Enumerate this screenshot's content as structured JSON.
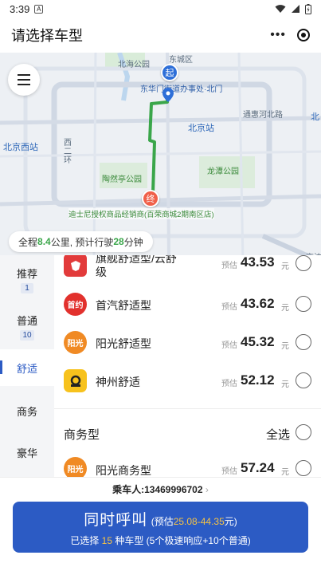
{
  "status_bar": {
    "time": "3:39",
    "notif": "A"
  },
  "header": {
    "title": "请选择车型",
    "more": "•••"
  },
  "map": {
    "labels": {
      "beihai": "北海公园",
      "dongcheng": "东城区",
      "dhm": "东华门街道办事处·北门",
      "tonghui": "通惠河北路",
      "bjz": "北京站",
      "bjxz": "北京西站",
      "erhuan": "西\n二\n环",
      "taoranting": "陶然亭公园",
      "longtan": "龙潭公园",
      "bei": "北",
      "jingshen": "京沈"
    },
    "start_marker": "起",
    "end_marker": "终",
    "destination": "迪士尼授权商品经销商(百荣商城2期南区店)",
    "trip": {
      "p1": "全程",
      "dist": "8.4",
      "p2": "公里, 预计行驶",
      "mins": "28",
      "p3": "分钟"
    }
  },
  "sidebar": {
    "categories": [
      {
        "label": "推荐",
        "count": "1"
      },
      {
        "label": "普通",
        "count": "10"
      },
      {
        "label": "舒适",
        "count": ""
      },
      {
        "label": "商务",
        "count": ""
      },
      {
        "label": "豪华",
        "count": ""
      }
    ]
  },
  "rides": [
    {
      "name_l1": "旗舰舒适型/云舒",
      "name_l2": "级",
      "est": "预估",
      "price": "43.53",
      "unit": "元",
      "logo_color": "#e23b3b"
    },
    {
      "name": "首汽舒适型",
      "logo_text": "首约",
      "est": "预估",
      "price": "43.62",
      "unit": "元",
      "logo_color": "#e2312d"
    },
    {
      "name": "阳光舒适型",
      "logo_text": "阳光",
      "est": "预估",
      "price": "45.32",
      "unit": "元",
      "logo_color": "#f08a24"
    },
    {
      "name": "神州舒适",
      "est": "预估",
      "price": "52.12",
      "unit": "元",
      "logo_color": "#f7c21d"
    }
  ],
  "business": {
    "title": "商务型",
    "select_all": "全选",
    "rides": [
      {
        "name": "阳光商务型",
        "logo_text": "阳光",
        "est": "预估",
        "price": "57.24",
        "unit": "元",
        "logo_color": "#f08a24"
      }
    ]
  },
  "footer": {
    "passenger_label": "乘车人:",
    "passenger_phone": "13469996702",
    "call_title": "同时呼叫",
    "est_prefix": "(预估",
    "est_range": "25.08-44.35",
    "est_suffix": "元)",
    "selected_prefix": "已选择",
    "selected_count": "15",
    "selected_suffix": "种车型 (5个极速响应+10个普通)"
  },
  "colors": {
    "accent": "#2c5bc4",
    "route": "#3aa64a",
    "price_highlight": "#f6c344"
  }
}
